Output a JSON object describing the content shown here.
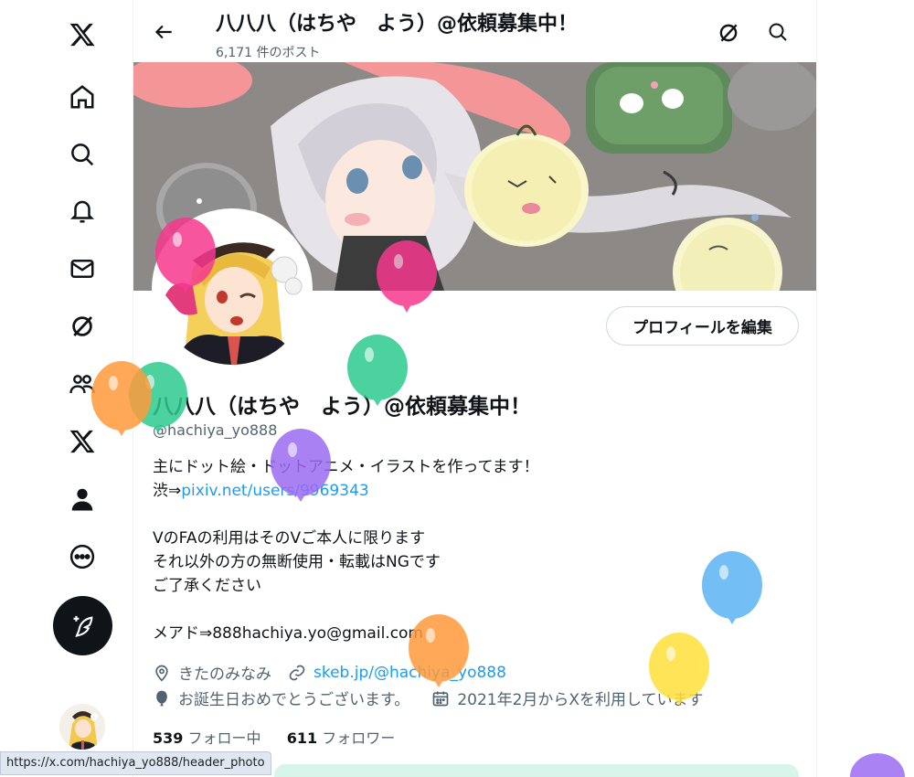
{
  "topbar": {
    "title": "八八八（はちや　よう）@依頼募集中！",
    "post_count": "6,171 件のポスト"
  },
  "profile": {
    "display_name": "八八八（はちや　よう）@依頼募集中！",
    "handle": "@hachiya_yo888",
    "edit_button": "プロフィールを編集",
    "bio": {
      "line1": "主にドット絵・ドットアニメ・イラストを作ってます！",
      "line2_prefix": "渋⇒",
      "line2_link": "pixiv.net/users/9969343",
      "line4": "VのFAの利用はそのVご本人に限ります",
      "line5": "それ以外の方の無断使用・転載はNGです",
      "line6": "ご了承ください",
      "line8": "メアド⇒888hachiya.yo@gmail.com"
    },
    "location": "きたのみなみ",
    "website": "skeb.jp/@hachiya_yo888",
    "birthday": "お誕生日おめでとうございます。",
    "joined": "2021年2月からXを利用しています",
    "following_count": "539",
    "following_label": "フォロー中",
    "followers_count": "611",
    "followers_label": "フォロワー"
  },
  "status_bar": {
    "url": "https://x.com/hachiya_yo888/header_photo"
  },
  "icons": {
    "nav": [
      "x-logo-icon",
      "home-icon",
      "search-icon",
      "notifications-icon",
      "messages-icon",
      "grok-icon",
      "communities-icon",
      "premium-x-icon",
      "profile-icon",
      "more-icon"
    ],
    "post": "compose-icon"
  },
  "colors": {
    "link": "#1d9bf0",
    "secondary_text": "#536471",
    "balloons": [
      "#f7388f",
      "#ff9a3c",
      "#2ccb8f",
      "#9b6cf2",
      "#5bb3f3",
      "#ffe03a"
    ]
  }
}
